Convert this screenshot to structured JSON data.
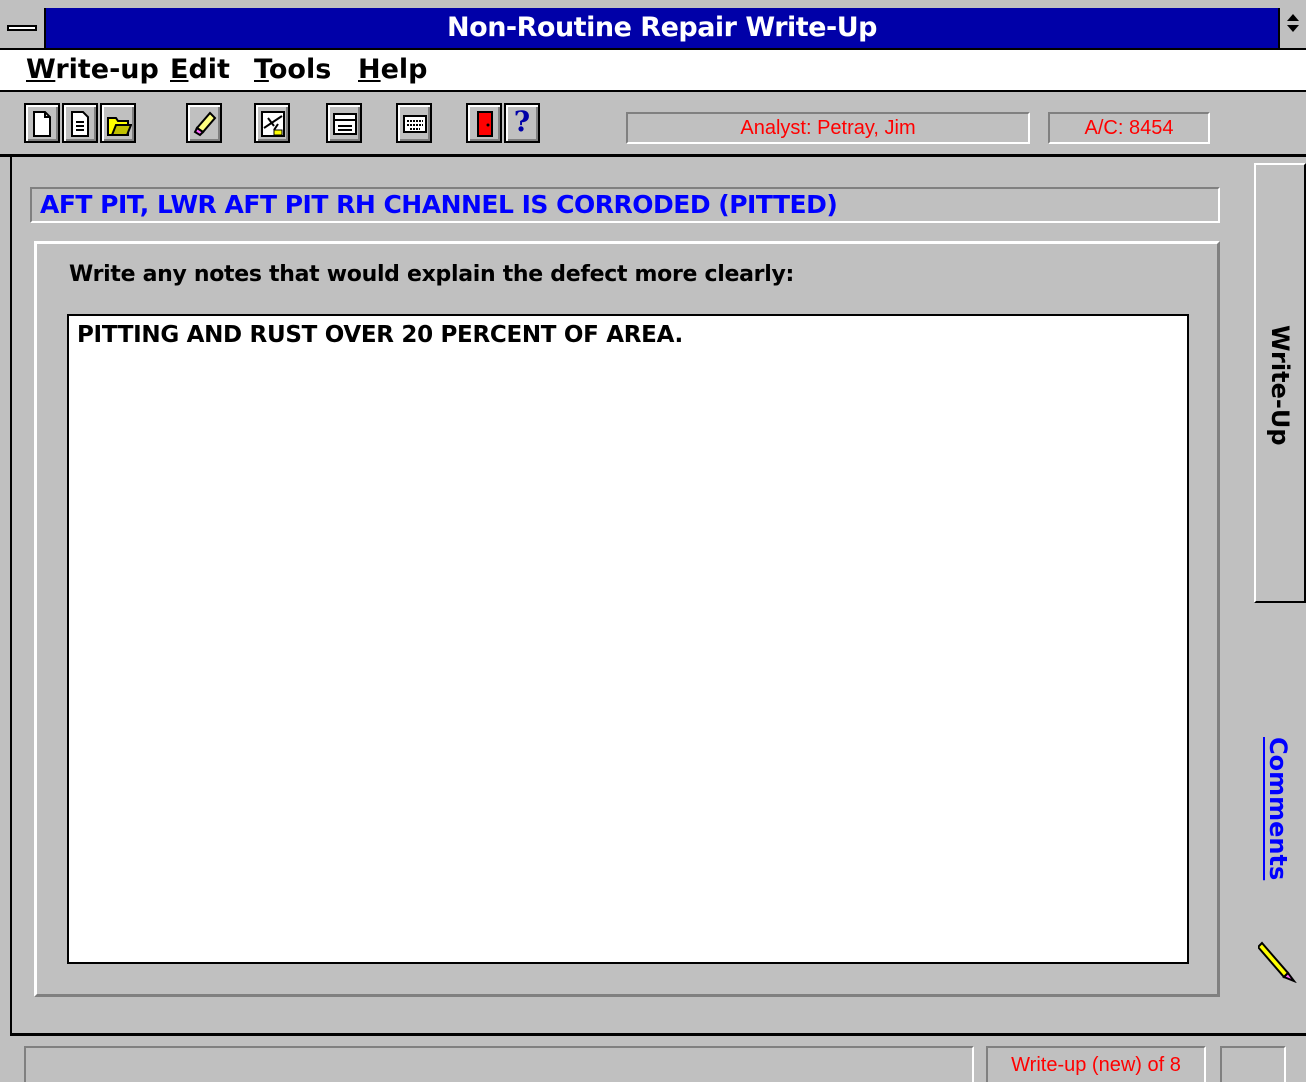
{
  "window": {
    "title": "Non-Routine Repair Write-Up"
  },
  "menu": [
    {
      "label": "Write-up",
      "accel": "W",
      "rest": "rite-up"
    },
    {
      "label": "Edit",
      "accel": "E",
      "rest": "dit"
    },
    {
      "label": "Tools",
      "accel": "T",
      "rest": "ools"
    },
    {
      "label": "Help",
      "accel": "H",
      "rest": "elp"
    }
  ],
  "toolbar": {
    "icons": [
      "new-document-icon",
      "view-document-icon",
      "open-folder-icon",
      "eraser-icon",
      "aircraft-icon",
      "form-icon",
      "keyboard-icon",
      "exit-door-icon",
      "help-icon"
    ],
    "help_label": "?",
    "analyst": "Analyst: Petray, Jim",
    "aircraft": "A/C: 8454"
  },
  "defect_title": "AFT PIT, LWR AFT PIT  RH CHANNEL IS CORRODED (PITTED)",
  "notes": {
    "prompt": "Write any notes that would explain the defect more clearly:",
    "value": "PITTING AND RUST OVER 20 PERCENT OF AREA."
  },
  "tabs": {
    "writeup": "Write-Up",
    "comments": "Comments",
    "active_color": "#000000",
    "comments_color": "#0000ff"
  },
  "statusbar": {
    "record": "Write-up (new) of 8"
  },
  "colors": {
    "title_bar": "#0000a8",
    "face": "#c0c0c0",
    "status_text": "#ff0000",
    "defect_text": "#0000ff"
  }
}
